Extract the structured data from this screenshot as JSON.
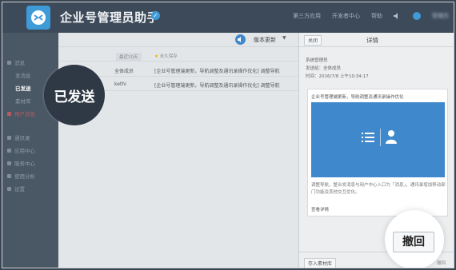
{
  "app": {
    "title": "企业号管理员助手"
  },
  "topnav": {
    "links": [
      "第三方应用",
      "开发者中心",
      "帮助"
    ],
    "user": "管理员"
  },
  "sidebar": {
    "items": [
      {
        "label": "消息",
        "level": 0,
        "active": false
      },
      {
        "label": "发消息",
        "level": 1,
        "active": false
      },
      {
        "label": "已发送",
        "level": 1,
        "active": true
      },
      {
        "label": "素材库",
        "level": 1,
        "active": false
      },
      {
        "label": "用户消息",
        "level": 0,
        "active": false,
        "alert": true
      },
      {
        "label": "通讯录",
        "level": 0,
        "active": false
      },
      {
        "label": "应用中心",
        "level": 0,
        "active": false
      },
      {
        "label": "服务中心",
        "level": 0,
        "active": false
      },
      {
        "label": "使用分析",
        "level": 0,
        "active": false
      },
      {
        "label": "设置",
        "level": 0,
        "active": false
      }
    ]
  },
  "magnifier": {
    "label": "已发送"
  },
  "version": {
    "label": "版本更新"
  },
  "filters": {
    "recent": "最近10天",
    "star": "永久保存"
  },
  "rows": [
    {
      "target": "全体成员",
      "content": "[企业号管理端更新，导航调整及通讯录操作优化] 调整导航"
    },
    {
      "target": "kethi",
      "content": "[企业号管理端更新，导航调整及通讯录操作优化] 调整导航"
    }
  ],
  "detail": {
    "close": "关闭",
    "title": "详情",
    "sender": "系统管理员",
    "to": "发送给：全体成员",
    "time": "时间：2016/7/8 上午10:34:17",
    "card_title": "企业号管理端更新，导航调整及通讯录操作优化",
    "card_desc": "调整导航，整合发消息与用户中心入口为「消息」，通讯录增加移动部门功能及其他交互优化。",
    "card_more": "查看详情",
    "to_material": "存入素材库",
    "foot_small": "撤回",
    "recall": "撤回"
  }
}
